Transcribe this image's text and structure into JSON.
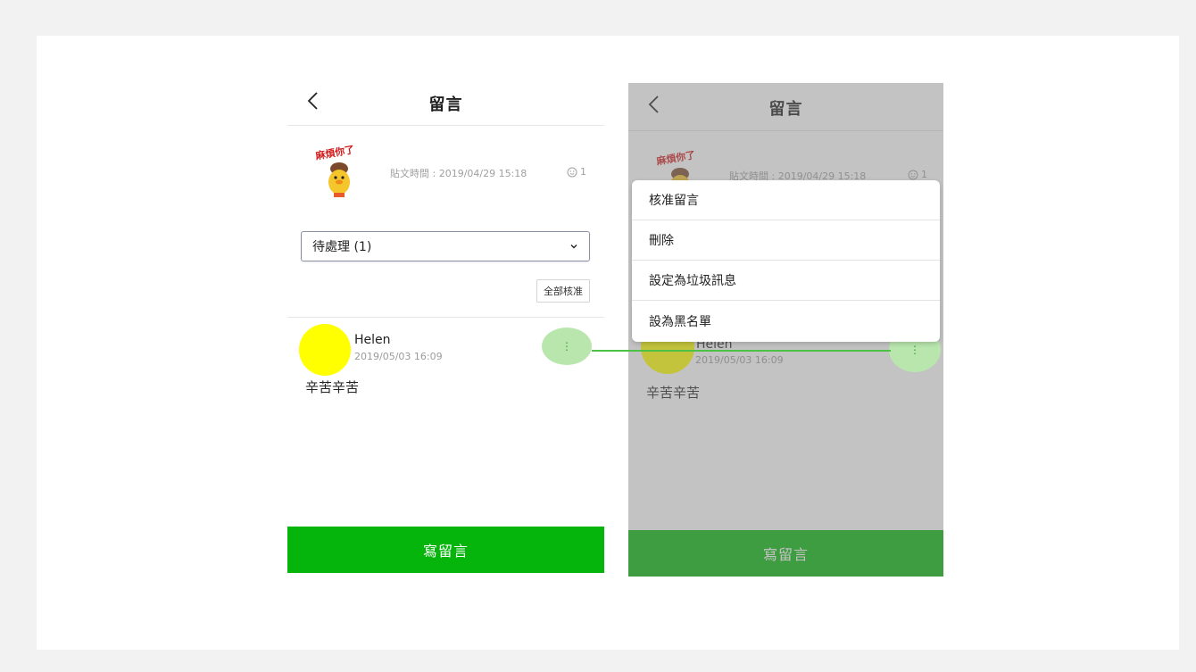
{
  "left_screen": {
    "title": "留言",
    "post_time": "貼文時間 : 2019/04/29 15:18",
    "reaction_count": "1",
    "filter": {
      "selected": "待處理 (1)"
    },
    "approve_all_label": "全部核准",
    "comment": {
      "name": "Helen",
      "time": "2019/05/03 16:09",
      "text": "辛苦辛苦"
    },
    "write_button_label": "寫留言"
  },
  "right_screen": {
    "title": "留言",
    "post_time": "貼文時間 : 2019/04/29 15:18",
    "reaction_count": "1",
    "comment": {
      "name": "Helen",
      "time": "2019/05/03 16:09",
      "text": "辛苦辛苦"
    },
    "menu_items": [
      {
        "label": "核准留言"
      },
      {
        "label": "刪除"
      },
      {
        "label": "設定為垃圾訊息"
      },
      {
        "label": "設為黑名單"
      }
    ],
    "write_button_label": "寫留言"
  },
  "sticker_text": "麻煩你了",
  "colors": {
    "brand_green": "#05b50b",
    "avatar_yellow": "#ffff00",
    "highlight_green": "#b8e6ad",
    "connector_green": "#4cc145"
  }
}
